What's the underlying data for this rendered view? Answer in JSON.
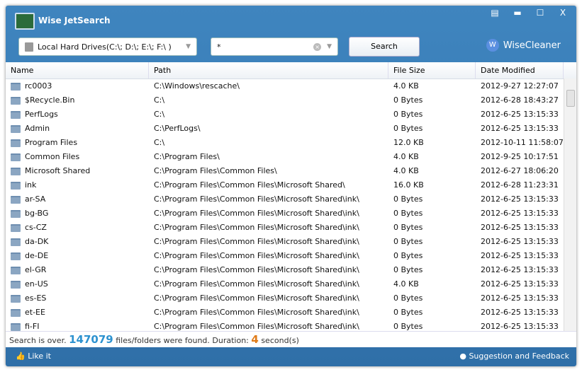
{
  "app": {
    "title": "Wise JetSearch",
    "brand": "WiseCleaner"
  },
  "toolbar": {
    "drive": "Local Hard Drives(C:\\; D:\\; E:\\; F:\\ )",
    "query": "*",
    "search_label": "Search"
  },
  "columns": [
    "Name",
    "Path",
    "File Size",
    "Date Modified"
  ],
  "rows": [
    [
      "rc0003",
      "C:\\Windows\\rescache\\",
      "4.0 KB",
      "2012-9-27 12:27:07"
    ],
    [
      "$Recycle.Bin",
      "C:\\",
      "0 Bytes",
      "2012-6-28 18:43:27"
    ],
    [
      "PerfLogs",
      "C:\\",
      "0 Bytes",
      "2012-6-25 13:15:33"
    ],
    [
      "Admin",
      "C:\\PerfLogs\\",
      "0 Bytes",
      "2012-6-25 13:15:33"
    ],
    [
      "Program Files",
      "C:\\",
      "12.0 KB",
      "2012-10-11 11:58:07"
    ],
    [
      "Common Files",
      "C:\\Program Files\\",
      "4.0 KB",
      "2012-9-25 10:17:51"
    ],
    [
      "Microsoft Shared",
      "C:\\Program Files\\Common Files\\",
      "4.0 KB",
      "2012-6-27 18:06:20"
    ],
    [
      "ink",
      "C:\\Program Files\\Common Files\\Microsoft Shared\\",
      "16.0 KB",
      "2012-6-28 11:23:31"
    ],
    [
      "ar-SA",
      "C:\\Program Files\\Common Files\\Microsoft Shared\\ink\\",
      "0 Bytes",
      "2012-6-25 13:15:33"
    ],
    [
      "bg-BG",
      "C:\\Program Files\\Common Files\\Microsoft Shared\\ink\\",
      "0 Bytes",
      "2012-6-25 13:15:33"
    ],
    [
      "cs-CZ",
      "C:\\Program Files\\Common Files\\Microsoft Shared\\ink\\",
      "0 Bytes",
      "2012-6-25 13:15:33"
    ],
    [
      "da-DK",
      "C:\\Program Files\\Common Files\\Microsoft Shared\\ink\\",
      "0 Bytes",
      "2012-6-25 13:15:33"
    ],
    [
      "de-DE",
      "C:\\Program Files\\Common Files\\Microsoft Shared\\ink\\",
      "0 Bytes",
      "2012-6-25 13:15:33"
    ],
    [
      "el-GR",
      "C:\\Program Files\\Common Files\\Microsoft Shared\\ink\\",
      "0 Bytes",
      "2012-6-25 13:15:33"
    ],
    [
      "en-US",
      "C:\\Program Files\\Common Files\\Microsoft Shared\\ink\\",
      "4.0 KB",
      "2012-6-25 13:15:33"
    ],
    [
      "es-ES",
      "C:\\Program Files\\Common Files\\Microsoft Shared\\ink\\",
      "0 Bytes",
      "2012-6-25 13:15:33"
    ],
    [
      "et-EE",
      "C:\\Program Files\\Common Files\\Microsoft Shared\\ink\\",
      "0 Bytes",
      "2012-6-25 13:15:33"
    ],
    [
      "fi-FI",
      "C:\\Program Files\\Common Files\\Microsoft Shared\\ink\\",
      "0 Bytes",
      "2012-6-25 13:15:33"
    ]
  ],
  "status": {
    "prefix": "Search is over.",
    "count": "147079",
    "mid": "files/folders were found. Duration:",
    "duration": "4",
    "suffix": "second(s)"
  },
  "footer": {
    "like": "Like it",
    "feedback": "Suggestion and Feedback"
  }
}
